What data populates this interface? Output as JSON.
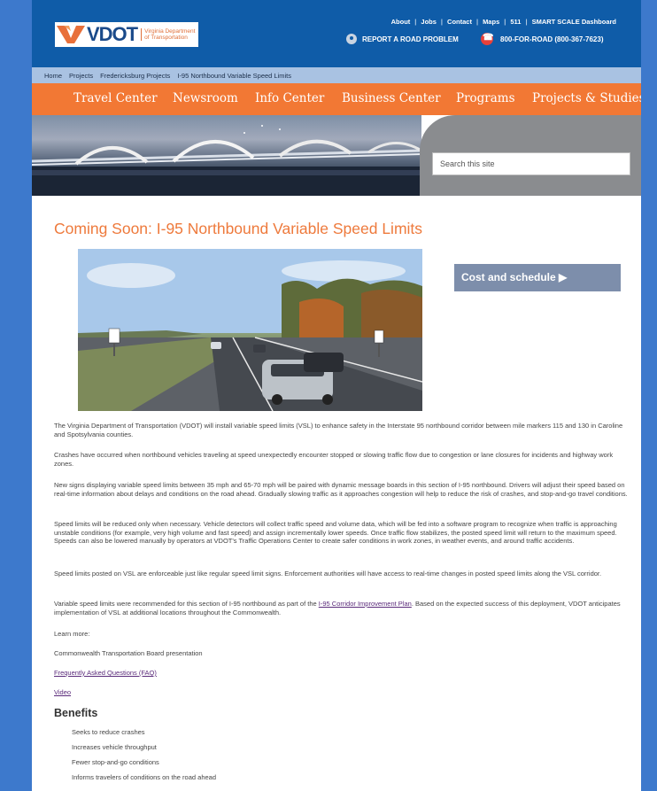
{
  "header": {
    "logo_text": "VDOT",
    "logo_subtitle_line1": "Virginia Department",
    "logo_subtitle_line2": "of Transportation",
    "top_links": [
      "About",
      "Jobs",
      "Contact",
      "Maps",
      "511",
      "SMART SCALE Dashboard"
    ],
    "report_label": "REPORT A ROAD PROBLEM",
    "phone_label": "800-FOR-ROAD (800-367-7623)"
  },
  "breadcrumb": [
    "Home",
    "Projects",
    "Fredericksburg Projects",
    "I-95 Northbound Variable Speed Limits"
  ],
  "nav": [
    "Travel Center",
    "Newsroom",
    "Info Center",
    "Business Center",
    "Programs",
    "Projects & Studies"
  ],
  "search": {
    "placeholder": "Search this site"
  },
  "page_title": "Coming Soon: I-95 Northbound Variable Speed Limits",
  "cost_button": "Cost and schedule ▶",
  "paragraphs": [
    "The Virginia Department of Transportation (VDOT) will install variable speed limits (VSL) to enhance safety in the Interstate 95 northbound corridor between mile markers 115 and 130 in Caroline and Spotsylvania counties.",
    "Crashes have occurred when northbound vehicles traveling at speed unexpectedly encounter stopped or slowing traffic flow due to congestion or lane closures for incidents and highway work zones.",
    "New signs displaying variable speed limits between 35 mph and 65-70 mph will be paired with dynamic message boards in this section of I-95 northbound. Drivers will adjust their speed based on real-time information about delays and conditions on the road ahead. Gradually slowing traffic as it approaches congestion will help to reduce the risk of crashes, and stop-and-go travel conditions.",
    "Speed limits will be reduced only when necessary. Vehicle detectors will collect traffic speed and volume data, which will be fed into a software program to recognize when traffic is approaching unstable conditions (for example, very high volume and fast speed) and assign incrementally lower speeds. Once traffic flow stabilizes, the posted speed limit will return to the maximum speed. Speeds can also be lowered manually by operators at VDOT's Traffic Operations Center to create safer conditions in work zones, in weather events, and around traffic accidents.",
    "Speed limits posted on VSL are enforceable just like regular speed limit signs. Enforcement authorities will have access to real-time changes in posted speed limits along the VSL corridor."
  ],
  "improvement_para": {
    "before": "Variable speed limits were recommended for this section of I-95 northbound as part of the ",
    "link": "I-95 Corridor Improvement Plan",
    "after": ". Based on the expected success of this deployment, VDOT anticipates implementation of VSL at additional locations throughout the Commonwealth."
  },
  "learn_more": "Learn more:",
  "ctb_presentation": "Commonwealth Transportation Board presentation",
  "faq_link": "Frequently Asked Questions (FAQ)",
  "video_link": "Video",
  "benefits_heading": "Benefits",
  "benefits": [
    "Seeks to reduce crashes",
    "Increases vehicle throughput",
    "Fewer stop-and-go conditions",
    "Informs travelers of conditions on the road ahead"
  ]
}
